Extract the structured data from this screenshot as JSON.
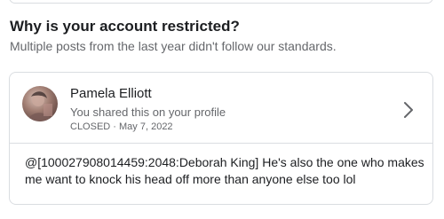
{
  "header": {
    "title": "Why is your account restricted?",
    "subtitle": "Multiple posts from the last year didn't follow our standards."
  },
  "post": {
    "author": "Pamela Elliott",
    "shared_text": "You shared this on your profile",
    "status": "CLOSED · May 7, 2022",
    "body": "@[100027908014459:2048:Deborah King] He's also the one who makes me want to knock his head off more than anyone else too lol"
  },
  "icons": {
    "avatar": "profile-photo",
    "chevron": "chevron-right-icon"
  },
  "colors": {
    "primary_text": "#1c1e21",
    "secondary_text": "#65676b",
    "border": "#dadde1"
  }
}
